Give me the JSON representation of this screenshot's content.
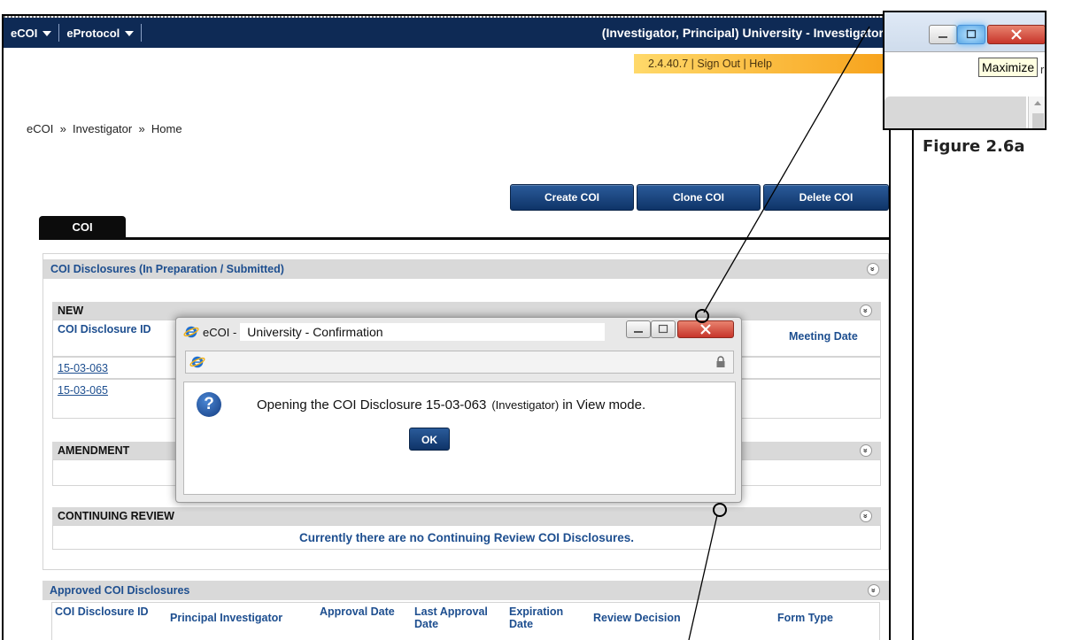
{
  "topnav": {
    "menus": [
      "eCOI",
      "eProtocol"
    ],
    "role": "(Investigator, Principal) University - Investigator"
  },
  "versionbar": {
    "version": "2.4.40.7",
    "sep1": " | ",
    "signout": "Sign Out",
    "sep2": " | ",
    "help": "Help"
  },
  "breadcrumb": "eCOI  »  Investigator  »  Home",
  "actions": {
    "create": "Create COI",
    "clone": "Clone COI",
    "delete": "Delete COI"
  },
  "tab": "COI",
  "prep": {
    "title": "COI Disclosures (In Preparation / Submitted)",
    "expand_glyph": "»",
    "new": {
      "title": "NEW",
      "col_id": "COI Disclosure ID",
      "col_meeting": "Meeting Date",
      "rows": [
        "15-03-063",
        "15-03-065"
      ]
    },
    "amendment": {
      "title": "AMENDMENT"
    },
    "continuing": {
      "title": "CONTINUING REVIEW",
      "message": "Currently there are no Continuing Review COI Disclosures."
    }
  },
  "approved": {
    "title": "Approved COI Disclosures",
    "columns": [
      "COI Disclosure ID",
      "Principal Investigator",
      "Approval Date",
      "Last Approval Date",
      "Expiration Date",
      "Review Decision",
      "Form Type"
    ]
  },
  "dialog": {
    "title_app": "eCOI -",
    "title": "University - Confirmation",
    "message_pre": "Opening the COI Disclosure 15-03-063",
    "message_role": "(Investigator)",
    "message_post": "in View mode.",
    "ok": "OK"
  },
  "inset": {
    "tooltip": "Maximize",
    "edge_text": "r:"
  },
  "figure_label": "Figure 2.6a",
  "colors": {
    "nav": "#0e2a55",
    "accent": "#1d4e8f",
    "version_bar": "#f7a21b"
  }
}
